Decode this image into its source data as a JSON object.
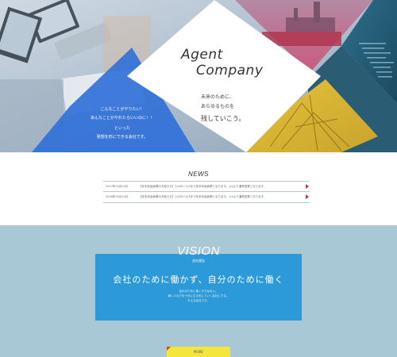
{
  "hero": {
    "title_line1": "Agent",
    "title_line2": "Company",
    "tagline1": "未来のために、",
    "tagline2": "あらゆるものを",
    "tagline3": "残していこう。",
    "blue_text1": "こんなことがやりたい！",
    "blue_text2": "あんなことがやれたらいいのに！！",
    "blue_text3": "といった",
    "blue_text4": "発想を形にできる会社です。"
  },
  "news": {
    "title": "NEWS",
    "rows": [
      {
        "date": "2017年10月19日",
        "text": "【年末年始休業のお知らせ】12/30〜1/3まで年末年始休業となります。1/4より通常営業となります。"
      },
      {
        "date": "2016年10月14日",
        "text": "【年末年始休業のお知らせ】12/30〜1/3まで年末年始休業となります。1/4より通常営業となります。"
      }
    ]
  },
  "vision": {
    "title": "VISION",
    "subtitle": "会社理念",
    "headline": "会社のために働かず、自分のために働く",
    "body1": "会社のために働くのではない。",
    "body2": "働く人の力を十分に引き出していく会社にする。",
    "body3": "そんな会社です。",
    "more_label": "MORE"
  },
  "colors": {
    "blue": "#2c9ad8",
    "hero_blue": "#2f6fd8",
    "red": "#d7332a",
    "yellow": "#f5e63c",
    "vision_bg": "#a8c8d6"
  }
}
